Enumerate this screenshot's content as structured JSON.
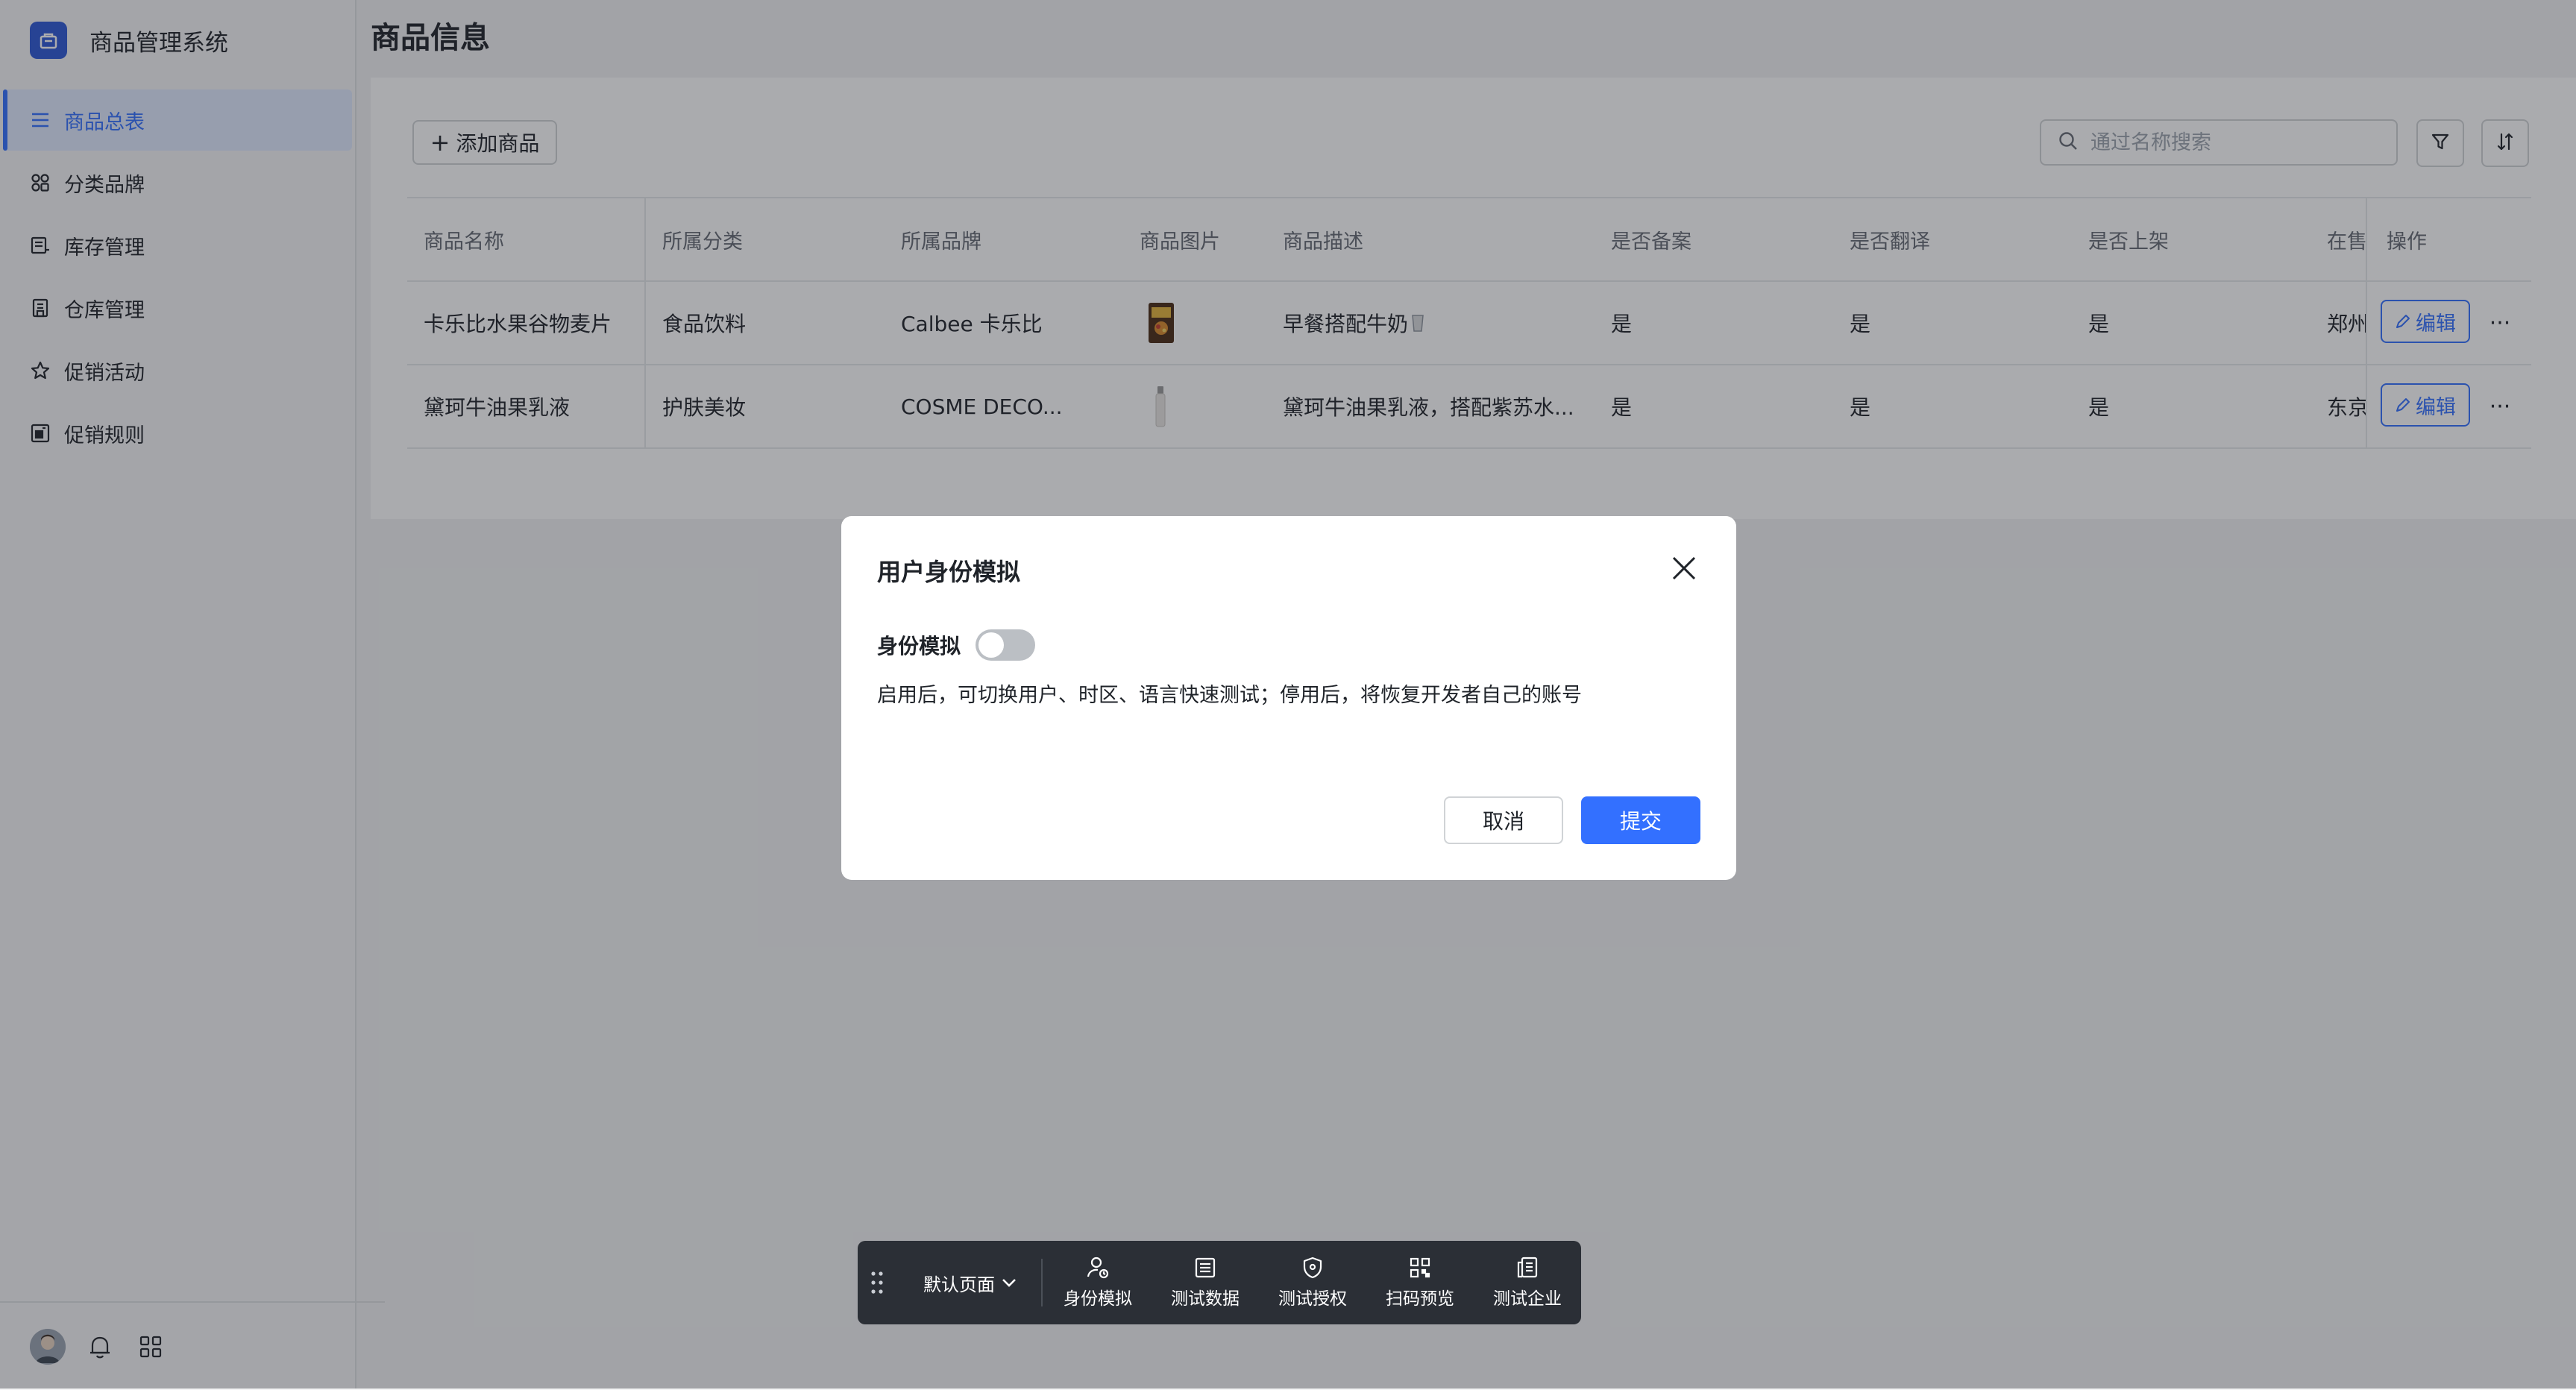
{
  "app": {
    "title": "商品管理系统"
  },
  "sidebar": {
    "items": [
      {
        "label": "商品总表",
        "icon": "list-icon",
        "active": true
      },
      {
        "label": "分类品牌",
        "icon": "category-icon",
        "active": false
      },
      {
        "label": "库存管理",
        "icon": "inventory-icon",
        "active": false
      },
      {
        "label": "仓库管理",
        "icon": "warehouse-icon",
        "active": false
      },
      {
        "label": "促销活动",
        "icon": "star-icon",
        "active": false
      },
      {
        "label": "促销规则",
        "icon": "rule-icon",
        "active": false
      }
    ],
    "footer_icons": [
      "avatar",
      "bell-icon",
      "apps-icon"
    ]
  },
  "page": {
    "title": "商品信息"
  },
  "toolbar_top": {
    "add_label": "添加商品",
    "search_placeholder": "通过名称搜索",
    "filter_icon": "filter-icon",
    "sort_icon": "sort-icon"
  },
  "table": {
    "columns": [
      "商品名称",
      "所属分类",
      "所属品牌",
      "商品图片",
      "商品描述",
      "是否备案",
      "是否翻译",
      "是否上架",
      "在售",
      "操作"
    ],
    "rows": [
      {
        "name": "卡乐比水果谷物麦片",
        "category": "食品饮料",
        "brand": "Calbee 卡乐比",
        "image": "cereal-image",
        "description": "早餐搭配牛奶",
        "filed": "是",
        "translated": "是",
        "listed": "是",
        "on_sale": "郑州",
        "edit_label": "编辑",
        "more_label": "···"
      },
      {
        "name": "黛珂牛油果乳液",
        "category": "护肤美妆",
        "brand": "COSME DECO...",
        "image": "lotion-image",
        "description": "黛珂牛油果乳液，搭配紫苏水...",
        "filed": "是",
        "translated": "是",
        "listed": "是",
        "on_sale": "东京",
        "edit_label": "编辑",
        "more_label": "···"
      }
    ]
  },
  "modal": {
    "title": "用户身份模拟",
    "toggle_label": "身份模拟",
    "toggle_on": false,
    "description": "启用后，可切换用户、时区、语言快速测试；停用后，将恢复开发者自己的账号",
    "cancel_label": "取消",
    "submit_label": "提交"
  },
  "dev_toolbar": {
    "page_select": "默认页面",
    "items": [
      {
        "label": "身份模拟",
        "icon": "user-switch-icon"
      },
      {
        "label": "测试数据",
        "icon": "data-icon"
      },
      {
        "label": "测试授权",
        "icon": "shield-icon"
      },
      {
        "label": "扫码预览",
        "icon": "qrcode-icon"
      },
      {
        "label": "测试企业",
        "icon": "enterprise-icon"
      }
    ]
  },
  "colors": {
    "primary": "#3370ff",
    "brand_logo": "#2c58d6",
    "toolbar_bg": "#2b2f36"
  }
}
